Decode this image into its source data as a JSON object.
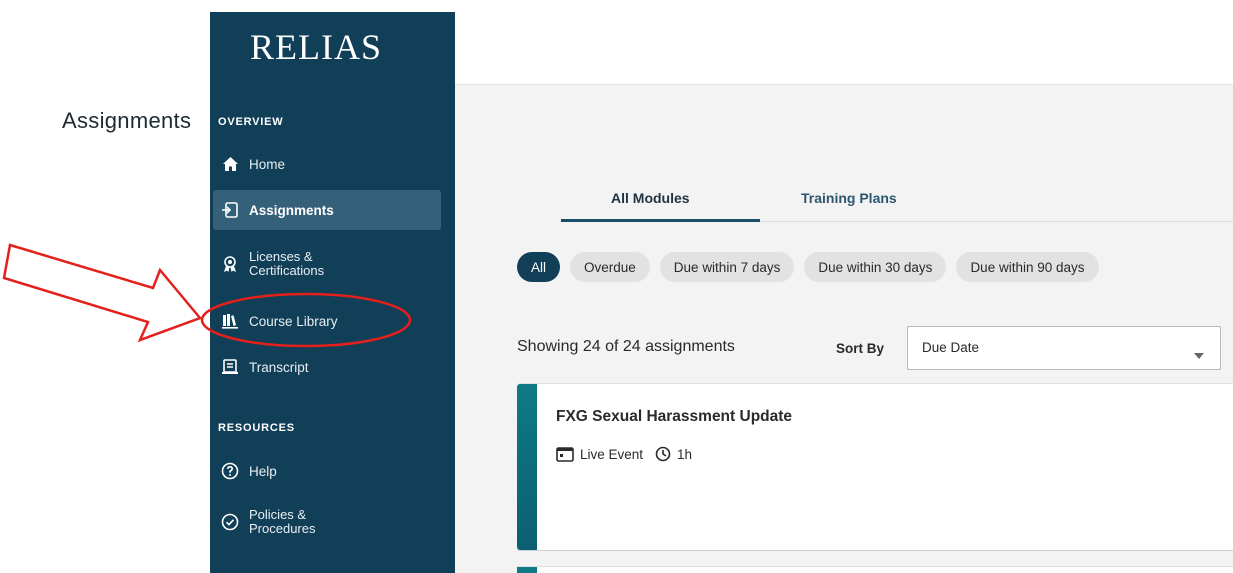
{
  "brand": {
    "logo_text": "RELIAS"
  },
  "sidebar": {
    "overview_label": "OVERVIEW",
    "resources_label": "RESOURCES",
    "items": [
      {
        "label": "Home",
        "icon": "home-icon"
      },
      {
        "label": "Assignments",
        "icon": "assignments-icon",
        "active": true
      },
      {
        "label_line1": "Licenses &",
        "label_line2": "Certifications",
        "icon": "ribbon-badge-icon"
      },
      {
        "label": "Course Library",
        "icon": "library-books-icon"
      },
      {
        "label": "Transcript",
        "icon": "transcript-icon"
      }
    ],
    "resource_items": [
      {
        "label": "Help",
        "icon": "help-circle-icon"
      },
      {
        "label_line1": "Policies &",
        "label_line2": "Procedures",
        "icon": "check-circle-icon"
      }
    ]
  },
  "main": {
    "title": "Assignments",
    "tabs": [
      {
        "label": "All Modules",
        "active": true
      },
      {
        "label": "Training Plans",
        "active": false
      }
    ],
    "filters": [
      {
        "label": "All",
        "active": true
      },
      {
        "label": "Overdue"
      },
      {
        "label": "Due within 7 days"
      },
      {
        "label": "Due within 30 days"
      },
      {
        "label": "Due within 90 days"
      }
    ],
    "showing_text": "Showing 24 of 24 assignments",
    "sort": {
      "label": "Sort By",
      "value": "Due Date"
    },
    "cards": [
      {
        "title": "FXG Sexual Harassment Update",
        "type": "Live Event",
        "duration": "1h"
      }
    ]
  },
  "colors": {
    "sidebar_bg": "#123f58",
    "sidebar_active_bg": "#35607a",
    "chip_active_bg": "#123f58",
    "card_accent": "#0e7a86",
    "annotation_red": "#e3201b"
  }
}
